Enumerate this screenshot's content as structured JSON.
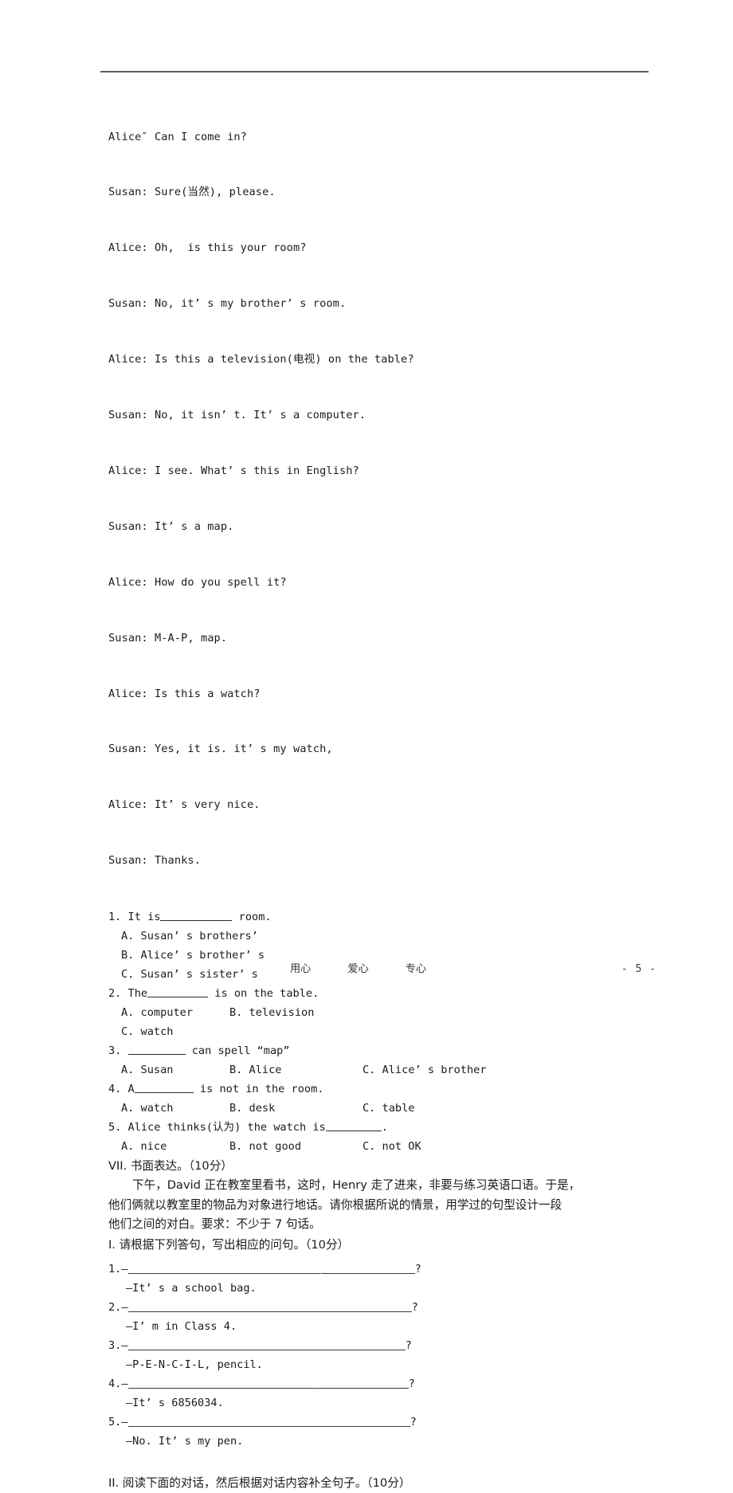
{
  "document": {
    "dialogue": [
      "Alice″ Can I come in?",
      "Susan: Sure(当然), please.",
      "Alice: Oh,  is this your room?",
      "Susan: No, it’ s my brother’ s room.",
      "Alice: Is this a television(电视) on the table?",
      "Susan: No, it isn’ t. It’ s a computer.",
      "Alice: I see. What’ s this in English?",
      "Susan: It’ s a map.",
      "Alice: How do you spell it?",
      "Susan: M-A-P, map.",
      "Alice: Is this a watch?",
      "Susan: Yes, it is. it’ s my watch,",
      "Alice: It’ s very nice.",
      "Susan: Thanks."
    ],
    "questions": [
      {
        "number": "1.",
        "stem_before": " It is",
        "stem_after": " room.",
        "options": [
          "A. Susan’ s brothers’",
          "B. Alice’ s brother’ s",
          "C. Susan’ s sister’ s"
        ],
        "layout": "stacked"
      },
      {
        "number": "2.",
        "stem_before": " The",
        "stem_after": " is on the table.",
        "options": [
          "A. computer",
          "B. television",
          "C. watch"
        ],
        "layout": "two-then-one"
      },
      {
        "number": "3.",
        "stem_before": " ",
        "stem_after": " can spell “map”",
        "options": [
          "A. Susan",
          "B. Alice",
          "C. Alice’ s brother"
        ],
        "layout": "row"
      },
      {
        "number": "4.",
        "stem_before": " A",
        "stem_after": " is not in the room.",
        "options": [
          "A. watch",
          "B. desk",
          "C. table"
        ],
        "layout": "row"
      },
      {
        "number": "5.",
        "stem_before": " Alice thinks(认为) the watch is",
        "stem_after": ".",
        "options": [
          "A. nice",
          "B. not good",
          "C. not OK"
        ],
        "layout": "row"
      }
    ],
    "writing_section": {
      "heading": "VII. 书面表达。（10分）",
      "paragraph_lines": [
        "下午，David 正在教室里看书，这时，Henry 走了进来，非要与练习英语口语。于是，",
        "他们俩就以教室里的物品为对象进行地话。请你根据所说的情景，用学过的句型设计一段",
        "他们之间的对白。要求：不少于 7 句话。"
      ]
    },
    "section_one": {
      "heading": "I. 请根据下列答句，写出相应的问句。（10分）",
      "items": [
        {
          "number": "1.",
          "dash": "—",
          "suffix": "?",
          "answer": "—It’ s a school bag."
        },
        {
          "number": "2.",
          "dash": "—",
          "suffix": "?",
          "answer": "—I’ m in Class 4."
        },
        {
          "number": "3.",
          "dash": "—",
          "suffix": "?",
          "answer": "—P-E-N-C-I-L, pencil."
        },
        {
          "number": "4.",
          "dash": "—",
          "suffix": "?",
          "answer": "—It’ s 6856034."
        },
        {
          "number": "5.",
          "dash": "—",
          "suffix": "?",
          "answer": "—No. It’ s my pen."
        }
      ]
    },
    "section_two": {
      "heading": "II. 阅读下面的对话，然后根据对话内容补全句子。（10分）"
    },
    "footer": {
      "motto": [
        "用心",
        "爱心",
        "专心"
      ],
      "page_number": "- 5 -"
    }
  }
}
